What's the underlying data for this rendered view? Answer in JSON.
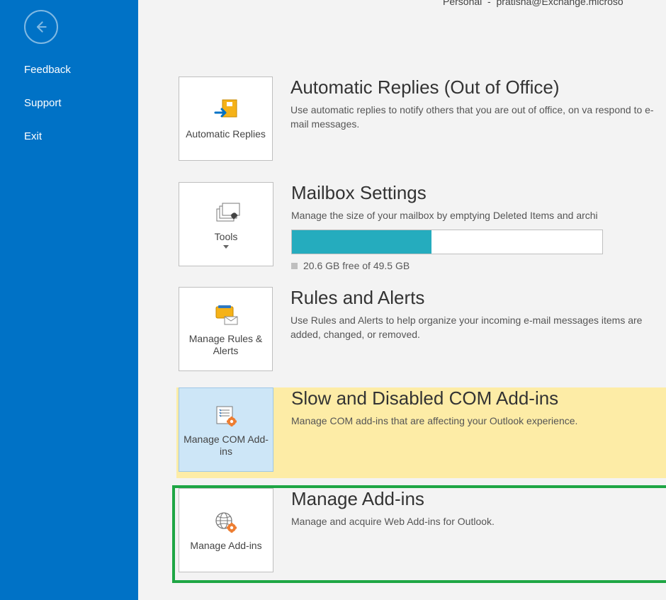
{
  "header": {
    "account_line_prefix": "Personal",
    "account_email_fragment": "pratisha@Exchange.microso"
  },
  "sidebar": {
    "items": [
      {
        "label": "Feedback"
      },
      {
        "label": "Support"
      },
      {
        "label": "Exit"
      }
    ]
  },
  "sections": {
    "autoreply": {
      "tile_label": "Automatic Replies",
      "title": "Automatic Replies (Out of Office)",
      "desc": "Use automatic replies to notify others that you are out of office, on va respond to e-mail messages."
    },
    "tools": {
      "tile_label": "Tools",
      "title": "Mailbox Settings",
      "desc": "Manage the size of your mailbox by emptying Deleted Items and archi",
      "usage_percent": 45,
      "usage_text": "20.6 GB free of 49.5 GB"
    },
    "rules": {
      "tile_label": "Manage Rules & Alerts",
      "title": "Rules and Alerts",
      "desc": "Use Rules and Alerts to help organize your incoming e-mail messages items are added, changed, or removed."
    },
    "com": {
      "tile_label": "Manage COM Add-ins",
      "title": "Slow and Disabled COM Add-ins",
      "desc": "Manage COM add-ins that are affecting your Outlook experience."
    },
    "addins": {
      "tile_label": "Manage Add-ins",
      "title": "Manage Add-ins",
      "desc": "Manage and acquire Web Add-ins for Outlook."
    }
  }
}
